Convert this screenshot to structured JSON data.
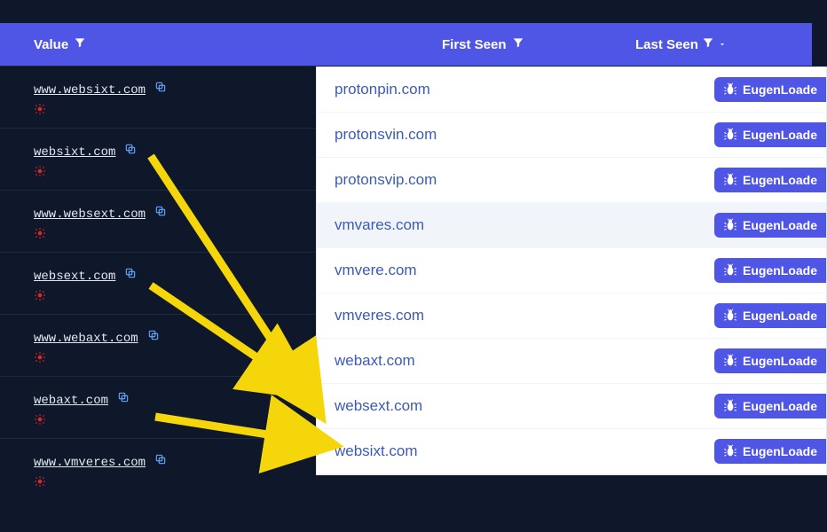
{
  "headers": {
    "value": "Value",
    "first_seen": "First Seen",
    "last_seen": "Last Seen"
  },
  "dark_rows": [
    {
      "domain": "www.websixt.com"
    },
    {
      "domain": "websixt.com"
    },
    {
      "domain": "www.websext.com"
    },
    {
      "domain": "websext.com"
    },
    {
      "domain": "www.webaxt.com"
    },
    {
      "domain": "webaxt.com"
    },
    {
      "domain": "www.vmveres.com"
    }
  ],
  "light_rows": [
    {
      "domain": "protonpin.com",
      "tag": "EugenLoade",
      "highlighted": false
    },
    {
      "domain": "protonsvin.com",
      "tag": "EugenLoade",
      "highlighted": false
    },
    {
      "domain": "protonsvip.com",
      "tag": "EugenLoade",
      "highlighted": false
    },
    {
      "domain": "vmvares.com",
      "tag": "EugenLoade",
      "highlighted": true
    },
    {
      "domain": "vmvere.com",
      "tag": "EugenLoade",
      "highlighted": false
    },
    {
      "domain": "vmveres.com",
      "tag": "EugenLoade",
      "highlighted": false
    },
    {
      "domain": "webaxt.com",
      "tag": "EugenLoade",
      "highlighted": false
    },
    {
      "domain": "websext.com",
      "tag": "EugenLoade",
      "highlighted": false
    },
    {
      "domain": "websixt.com",
      "tag": "EugenLoade",
      "highlighted": false
    }
  ]
}
